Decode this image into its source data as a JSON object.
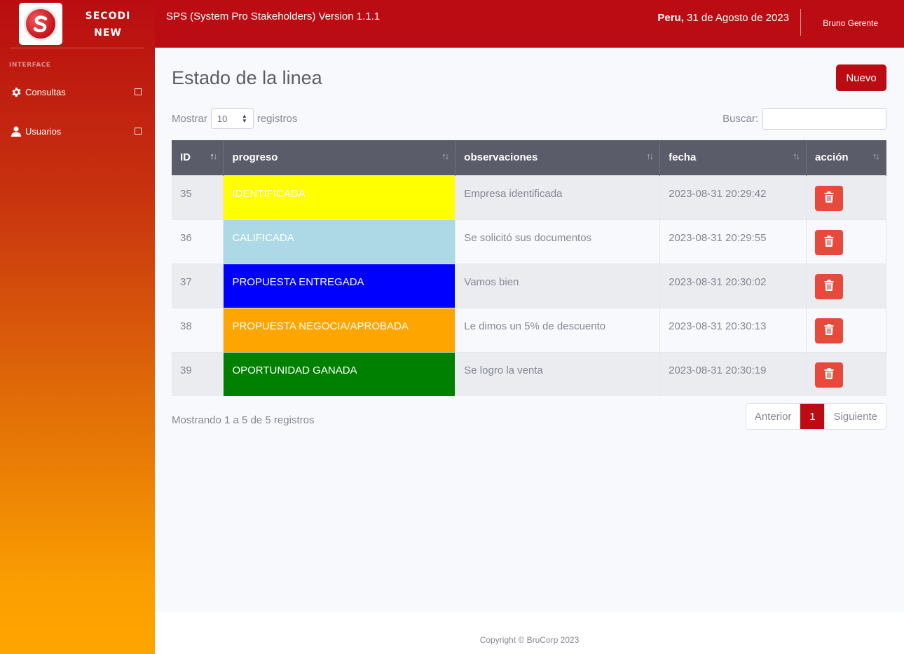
{
  "sidebar": {
    "brand_line1": "SECODI",
    "brand_line2": "NEW",
    "heading": "INTERFACE",
    "items": [
      {
        "label": "Consultas",
        "icon": "gear-icon"
      },
      {
        "label": "Usuarios",
        "icon": "user-icon"
      }
    ],
    "gradient": [
      "#b90d11",
      "#ffa500"
    ]
  },
  "topbar": {
    "title": "SPS (System Pro Stakeholders) Version 1.1.1",
    "date_bold": "Peru,",
    "date_rest": " 31 de Agosto de 2023",
    "user": "Bruno Gerente",
    "color": "#ba0c12"
  },
  "page": {
    "title": "Estado de la linea",
    "new_button": "Nuevo",
    "show_label": "Mostrar",
    "show_value": "10",
    "records_label": "registros",
    "search_label": "Buscar:",
    "search_value": ""
  },
  "table": {
    "columns": [
      "ID",
      "progreso",
      "observaciones",
      "fecha",
      "acción"
    ],
    "rows": [
      {
        "id": "35",
        "progreso": "IDENTIFICADA",
        "color": "#ffff00",
        "observaciones": "Empresa identificada",
        "fecha": "2023-08-31 20:29:42"
      },
      {
        "id": "36",
        "progreso": "CALIFICADA",
        "color": "#add8e6",
        "observaciones": "Se solicitó sus documentos",
        "fecha": "2023-08-31 20:29:55"
      },
      {
        "id": "37",
        "progreso": "PROPUESTA ENTREGADA",
        "color": "#0000ff",
        "observaciones": "Vamos bien",
        "fecha": "2023-08-31 20:30:02"
      },
      {
        "id": "38",
        "progreso": "PROPUESTA NEGOCIA/APROBADA",
        "color": "#ffa500",
        "observaciones": "Le dimos un 5% de descuento",
        "fecha": "2023-08-31 20:30:13"
      },
      {
        "id": "39",
        "progreso": "OPORTUNIDAD GANADA",
        "color": "#008000",
        "observaciones": "Se logro la venta",
        "fecha": "2023-08-31 20:30:19"
      }
    ],
    "delete_icon": "trash-icon",
    "delete_color": "#e74a3b"
  },
  "footer_table": {
    "info": "Mostrando 1 a 5 de 5 registros",
    "prev": "Anterior",
    "page": "1",
    "next": "Siguiente"
  },
  "footer": {
    "copyright": "Copyright © BruCorp 2023"
  }
}
